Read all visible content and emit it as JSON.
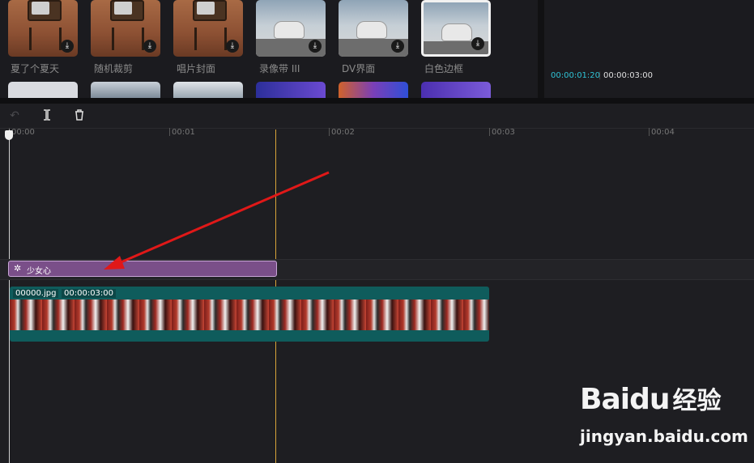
{
  "templates": [
    {
      "label": "夏了个夏天",
      "style": "tv"
    },
    {
      "label": "随机裁剪",
      "style": "tv"
    },
    {
      "label": "唱片封面",
      "style": "tv"
    },
    {
      "label": "录像带 III",
      "style": "car"
    },
    {
      "label": "DV界面",
      "style": "car"
    },
    {
      "label": "白色边框",
      "style": "car-white"
    }
  ],
  "row2_colors": [
    "#d9dbe0",
    "#8c98a6",
    "#b8c3cc",
    "#3a3aa8",
    "#7a3fb8",
    "#5b3ec9"
  ],
  "preview": {
    "current_time": "00:00:01:20",
    "total_time": "00:00:03:00",
    "separator": "|"
  },
  "toolbar": {
    "undo_icon": "undo-icon",
    "split_icon": "split-icon",
    "delete_icon": "trash-icon"
  },
  "ruler": {
    "ticks": [
      "00:00",
      "00:01",
      "00:02",
      "00:03",
      "00:04"
    ]
  },
  "effect_clip": {
    "label": "少女心",
    "icon": "effect-icon",
    "color": "#7a4f89"
  },
  "video_clip": {
    "filename": "00000.jpg",
    "duration": "00:00:03:00",
    "color": "#0f5c5c"
  },
  "watermark": {
    "brand": "Bai",
    "brand2": "du",
    "cn": "经验",
    "url": "jingyan.baidu.com"
  }
}
